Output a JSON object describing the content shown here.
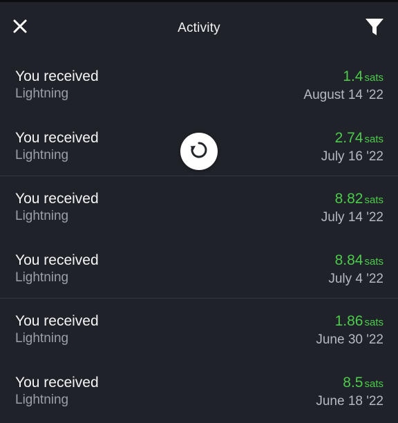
{
  "header": {
    "title": "Activity",
    "close_icon": "close-icon",
    "filter_icon": "filter-icon"
  },
  "refresh_icon": "refresh-icon",
  "colors": {
    "background": "#1f2228",
    "amount": "#4ccb4c",
    "primary_text": "#f4f5f7",
    "secondary_text": "#9aa0aa"
  },
  "transactions": [
    {
      "title": "You received",
      "subtitle": "Lightning",
      "amount": "1.4",
      "unit": "sats",
      "date": "August 14 '22"
    },
    {
      "title": "You received",
      "subtitle": "Lightning",
      "amount": "2.74",
      "unit": "sats",
      "date": "July 16 '22"
    },
    {
      "title": "You received",
      "subtitle": "Lightning",
      "amount": "8.82",
      "unit": "sats",
      "date": "July 14 '22"
    },
    {
      "title": "You received",
      "subtitle": "Lightning",
      "amount": "8.84",
      "unit": "sats",
      "date": "July 4 '22"
    },
    {
      "title": "You received",
      "subtitle": "Lightning",
      "amount": "1.86",
      "unit": "sats",
      "date": "June 30 '22"
    },
    {
      "title": "You received",
      "subtitle": "Lightning",
      "amount": "8.5",
      "unit": "sats",
      "date": "June 18 '22"
    }
  ]
}
